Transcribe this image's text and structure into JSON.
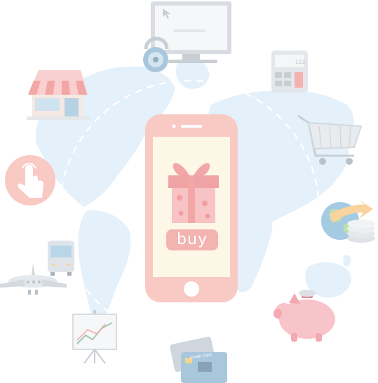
{
  "phone": {
    "buy_label": "buy"
  },
  "credit_card": {
    "label": "Credit Card"
  },
  "calculator": {
    "display": "123"
  },
  "colors": {
    "map": "#e4f0fa",
    "phone_body": "#f9c9c4",
    "phone_screen": "#fdf7e8",
    "accent": "#f2b3b1",
    "dashed_path": "#ffffff"
  },
  "icons": [
    "world-map",
    "smartphone",
    "gift-icon",
    "computer-monitor-icon",
    "padlock-icon",
    "calculator-icon",
    "storefront-icon",
    "shopping-cart-icon",
    "touch-hand-icon",
    "globe-coins-icon",
    "bus-icon",
    "airplane-icon",
    "piggy-bank-icon",
    "chart-board-icon",
    "credit-card-icon"
  ]
}
